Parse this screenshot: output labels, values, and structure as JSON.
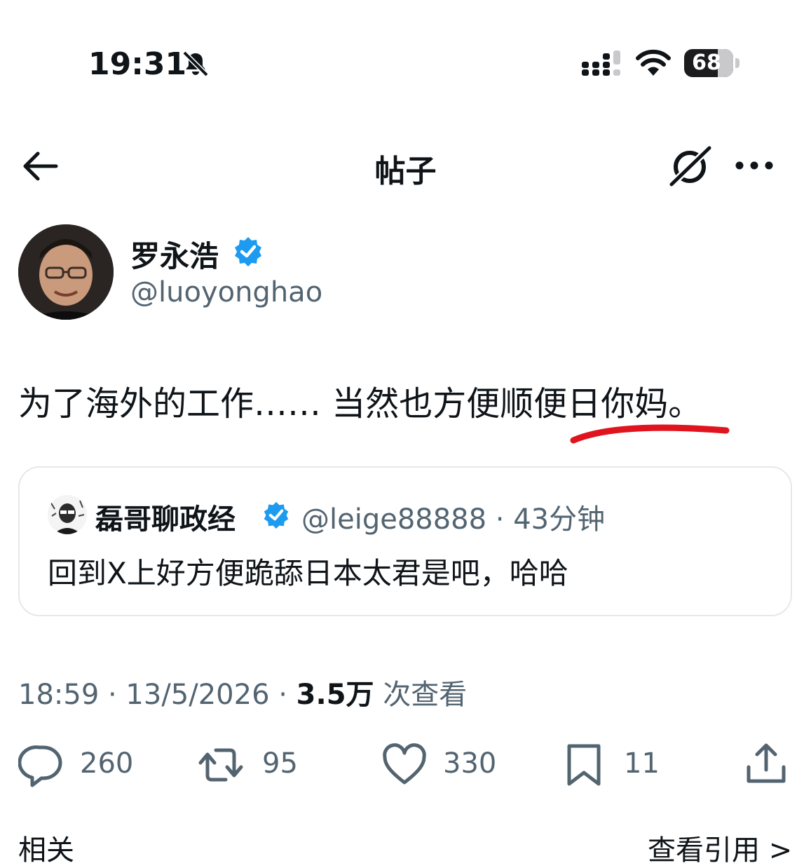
{
  "status_bar": {
    "time": "19:31",
    "battery": "68",
    "icons": [
      "bell-slash-icon",
      "signal-icon",
      "wifi-icon",
      "battery-icon"
    ]
  },
  "header": {
    "title": "帖子",
    "icons": [
      "back-arrow-icon",
      "grok-icon",
      "more-icon"
    ]
  },
  "post": {
    "author_name": "罗永浩",
    "author_handle": "@luoyonghao",
    "text": "为了海外的工作…… 当然也方便顺便日你妈。",
    "timestamp": "18:59 · 13/5/2026 · ",
    "views_count": "3.5万",
    "views_label": " 次查看"
  },
  "quote": {
    "author_name": "磊哥聊政经",
    "meta": "@leige88888 · 43分钟",
    "text": "回到X上好方便跪舔日本太君是吧，哈哈"
  },
  "actions": {
    "replies": "260",
    "reposts": "95",
    "likes": "330",
    "bookmarks": "11"
  },
  "bottom": {
    "left_label": "相关",
    "right_label": "查看引用 >"
  },
  "colors": {
    "verified": "#1d9bf0",
    "secondary_text": "#536471",
    "annotation": "#e0141e"
  }
}
